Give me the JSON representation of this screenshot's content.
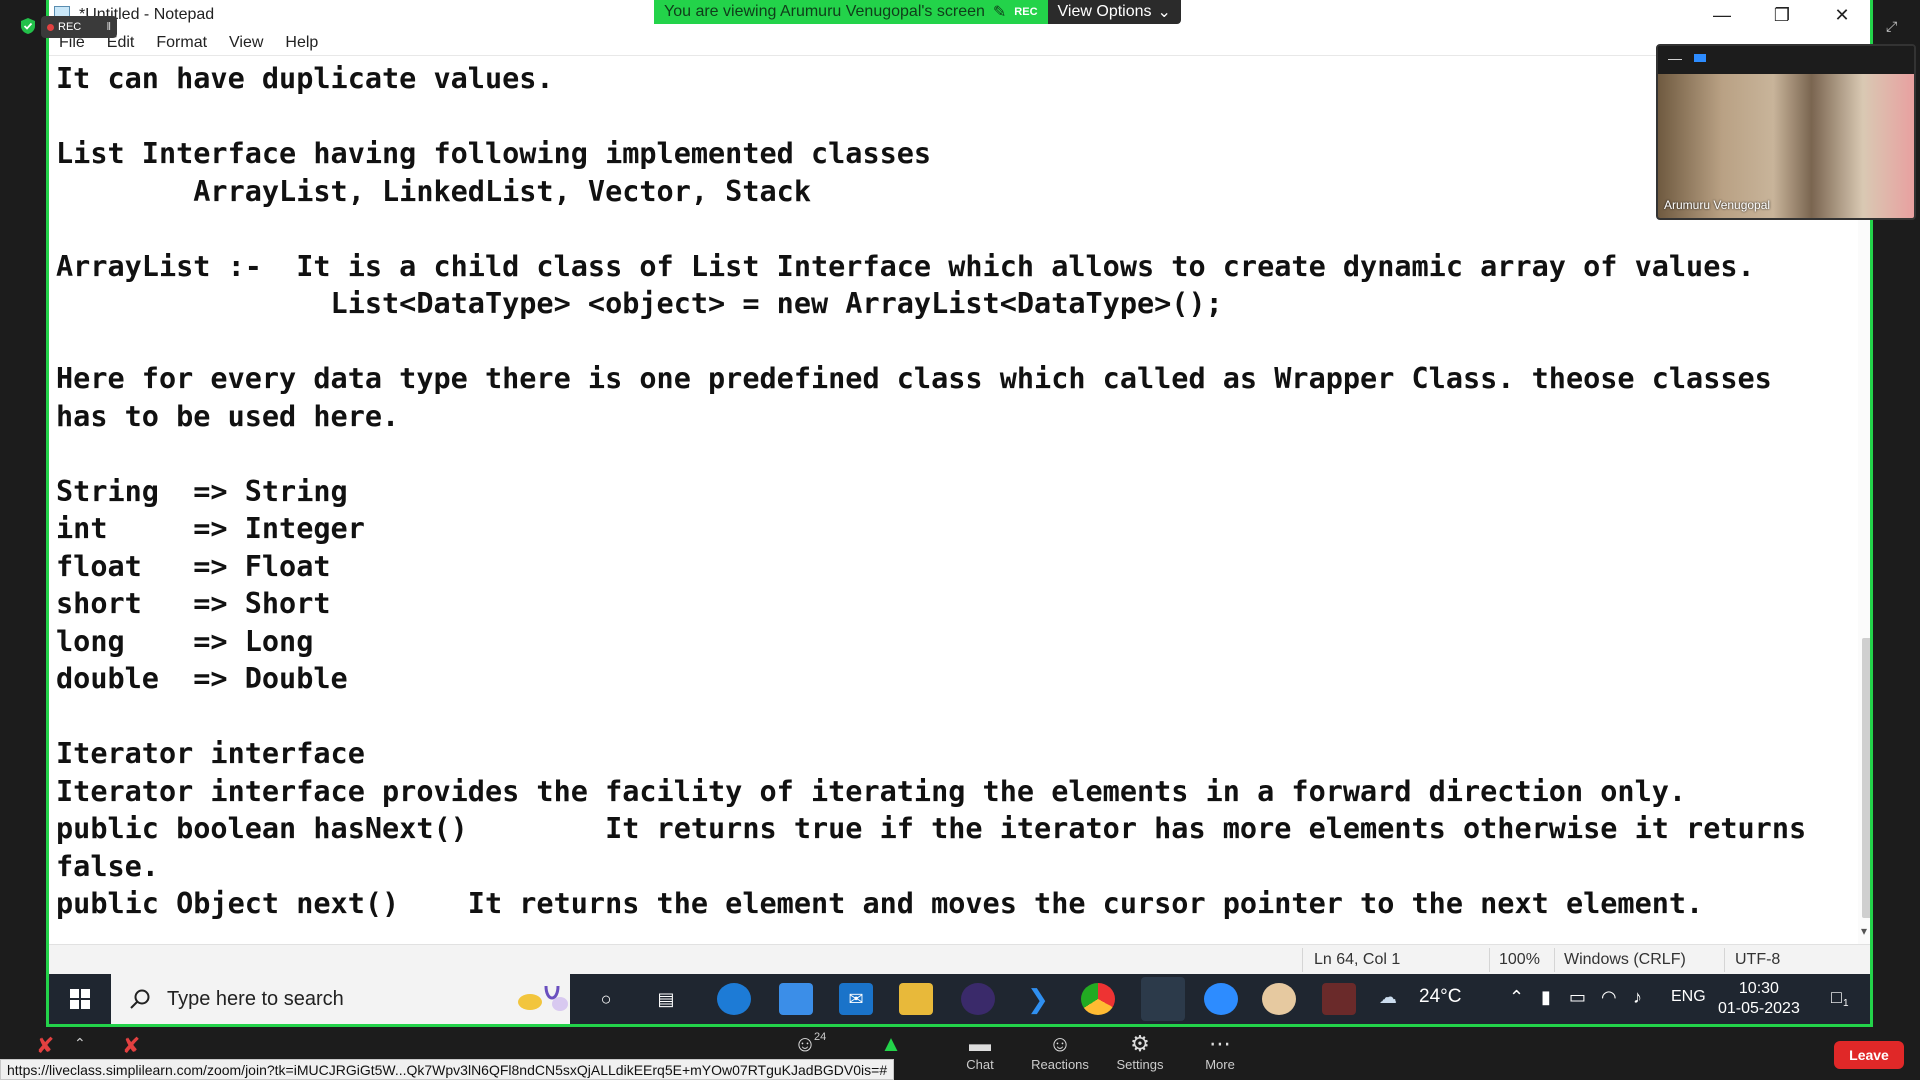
{
  "zoom": {
    "rec_label": "REC",
    "banner_text": "You are viewing Arumuru Venugopal's screen",
    "banner_rec": "REC",
    "view_options_label": "View Options",
    "participant_name": "Arumuru Venugopal",
    "participants_count": "24",
    "toolbar": {
      "chat": "Chat",
      "reactions": "Reactions",
      "settings": "Settings",
      "more": "More",
      "leave": "Leave"
    },
    "url": "https://liveclass.simplilearn.com/zoom/join?tk=iMUCJRGiGt5W...Qk7Wpv3lN6QFl8ndCN5sxQjALLdikEErq5E+mYOw07RTguKJadBGDV0is=#"
  },
  "notepad": {
    "title": "*Untitled - Notepad",
    "menu": [
      "File",
      "Edit",
      "Format",
      "View",
      "Help"
    ],
    "lines": [
      "It can have duplicate values.",
      "",
      "List Interface having following implemented classes",
      "        ArrayList, LinkedList, Vector, Stack",
      "",
      "ArrayList :-  It is a child class of List Interface which allows to create dynamic array of values.",
      "                List<DataType> <object> = new ArrayList<DataType>();",
      "",
      "Here for every data type there is one predefined class which called as Wrapper Class. theose classes",
      "has to be used here.",
      "",
      "String  => String",
      "int     => Integer",
      "float   => Float",
      "short   => Short",
      "long    => Long",
      "double  => Double",
      "",
      "Iterator interface",
      "Iterator interface provides the facility of iterating the elements in a forward direction only.",
      "public boolean hasNext()        It returns true if the iterator has more elements otherwise it returns",
      "false.",
      "public Object next()    It returns the element and moves the cursor pointer to the next element."
    ],
    "status": {
      "position": "Ln 64, Col 1",
      "zoom": "100%",
      "line_ending": "Windows (CRLF)",
      "encoding": "UTF-8"
    }
  },
  "taskbar": {
    "search_placeholder": "Type here to search",
    "weather": "24°C",
    "language": "ENG",
    "time": "10:30",
    "date": "01-05-2023",
    "notification_count": "1"
  },
  "colors": {
    "share_border": "#23d34a",
    "leave_button": "#e02828",
    "taskbar": "#1f2630"
  }
}
